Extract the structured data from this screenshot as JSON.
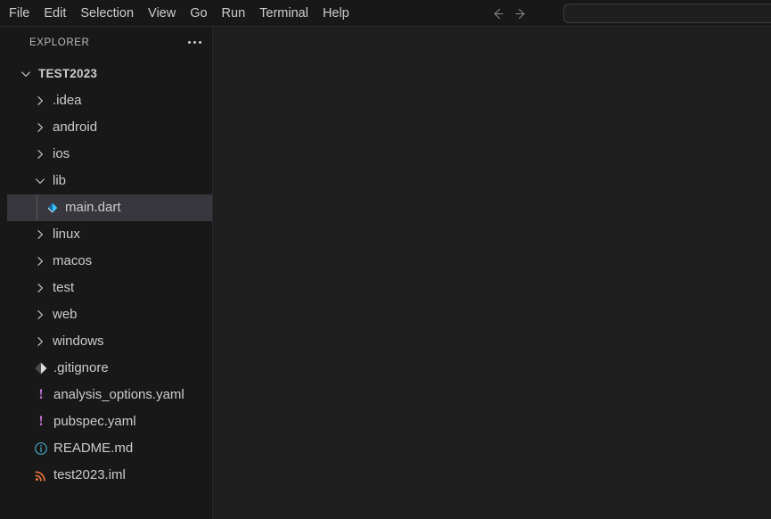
{
  "window": {
    "background": "#1f1f1f",
    "titlebar_background": "#181818",
    "sidebar_background": "#181818",
    "selection_background": "#37373d",
    "text_color": "#cccccc"
  },
  "menubar": {
    "items": [
      {
        "label": "File",
        "name": "menu-file"
      },
      {
        "label": "Edit",
        "name": "menu-edit"
      },
      {
        "label": "Selection",
        "name": "menu-selection"
      },
      {
        "label": "View",
        "name": "menu-view"
      },
      {
        "label": "Go",
        "name": "menu-go"
      },
      {
        "label": "Run",
        "name": "menu-run"
      },
      {
        "label": "Terminal",
        "name": "menu-terminal"
      },
      {
        "label": "Help",
        "name": "menu-help"
      }
    ]
  },
  "navigation": {
    "back_icon": "arrow-left-icon",
    "forward_icon": "arrow-right-icon"
  },
  "command_center": {
    "value": "",
    "placeholder": ""
  },
  "sidebar": {
    "title": "EXPLORER",
    "more_actions_icon": "ellipsis-icon",
    "tree": [
      {
        "label": "TEST2023",
        "type": "root-folder",
        "expanded": true,
        "depth": 0,
        "icon": "chevron-down-icon",
        "selected": false,
        "name": "tree-item-test2023"
      },
      {
        "label": ".idea",
        "type": "folder",
        "expanded": false,
        "depth": 1,
        "icon": "chevron-right-icon",
        "selected": false,
        "name": "tree-item-idea"
      },
      {
        "label": "android",
        "type": "folder",
        "expanded": false,
        "depth": 1,
        "icon": "chevron-right-icon",
        "selected": false,
        "name": "tree-item-android"
      },
      {
        "label": "ios",
        "type": "folder",
        "expanded": false,
        "depth": 1,
        "icon": "chevron-right-icon",
        "selected": false,
        "name": "tree-item-ios"
      },
      {
        "label": "lib",
        "type": "folder",
        "expanded": true,
        "depth": 1,
        "icon": "chevron-down-icon",
        "selected": false,
        "name": "tree-item-lib"
      },
      {
        "label": "main.dart",
        "type": "file",
        "depth": 2,
        "icon": "dart-file-icon",
        "icon_color": "#40c4ff",
        "selected": true,
        "name": "tree-item-main-dart"
      },
      {
        "label": "linux",
        "type": "folder",
        "expanded": false,
        "depth": 1,
        "icon": "chevron-right-icon",
        "selected": false,
        "name": "tree-item-linux"
      },
      {
        "label": "macos",
        "type": "folder",
        "expanded": false,
        "depth": 1,
        "icon": "chevron-right-icon",
        "selected": false,
        "name": "tree-item-macos"
      },
      {
        "label": "test",
        "type": "folder",
        "expanded": false,
        "depth": 1,
        "icon": "chevron-right-icon",
        "selected": false,
        "name": "tree-item-test"
      },
      {
        "label": "web",
        "type": "folder",
        "expanded": false,
        "depth": 1,
        "icon": "chevron-right-icon",
        "selected": false,
        "name": "tree-item-web"
      },
      {
        "label": "windows",
        "type": "folder",
        "expanded": false,
        "depth": 1,
        "icon": "chevron-right-icon",
        "selected": false,
        "name": "tree-item-windows"
      },
      {
        "label": ".gitignore",
        "type": "file",
        "depth": 1,
        "icon": "git-file-icon",
        "icon_color": "#9aa0a6",
        "selected": false,
        "name": "tree-item-gitignore"
      },
      {
        "label": "analysis_options.yaml",
        "type": "file",
        "depth": 1,
        "icon": "yaml-file-icon",
        "icon_color": "#c678dd",
        "selected": false,
        "name": "tree-item-analysis-options-yaml"
      },
      {
        "label": "pubspec.yaml",
        "type": "file",
        "depth": 1,
        "icon": "yaml-file-icon",
        "icon_color": "#c678dd",
        "selected": false,
        "name": "tree-item-pubspec-yaml"
      },
      {
        "label": "README.md",
        "type": "file",
        "depth": 1,
        "icon": "info-file-icon",
        "icon_color": "#42a5c4",
        "selected": false,
        "name": "tree-item-readme-md"
      },
      {
        "label": "test2023.iml",
        "type": "file",
        "depth": 1,
        "icon": "iml-file-icon",
        "icon_color": "#e8763a",
        "selected": false,
        "name": "tree-item-test2023-iml"
      }
    ]
  },
  "editor": {
    "content": ""
  }
}
